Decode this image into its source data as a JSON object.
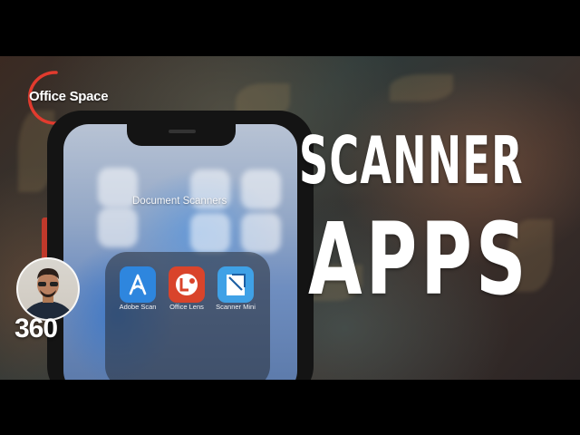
{
  "logo": {
    "text": "Office Space",
    "ring_color": "#e23b2e"
  },
  "phone": {
    "folder_title": "Document Scanners",
    "apps": [
      {
        "label": "Adobe Scan",
        "icon": "adobe-scan-icon",
        "color": "#2e86de"
      },
      {
        "label": "Office Lens",
        "icon": "office-lens-icon",
        "color": "#d9442b"
      },
      {
        "label": "Scanner Mini",
        "icon": "scanner-mini-icon",
        "color": "#3fa1e6"
      }
    ]
  },
  "title": {
    "line1": "SCANNER",
    "line2": "APPS"
  },
  "badge": {
    "text": "360",
    "avatar": "host-avatar-icon"
  }
}
